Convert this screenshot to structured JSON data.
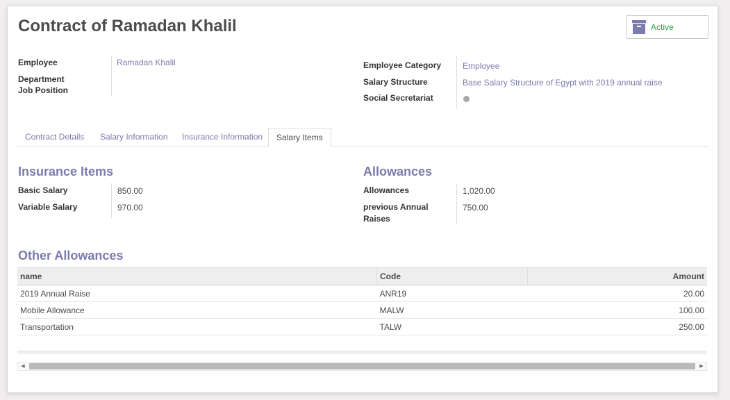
{
  "header": {
    "title": "Contract of Ramadan Khalil",
    "status_label": "Active",
    "status_icon": "archive-icon"
  },
  "left_fields": [
    {
      "label": "Employee",
      "value": "Ramadan Khalil"
    },
    {
      "label": "Department",
      "value": ""
    },
    {
      "label": "Job Position",
      "value": ""
    }
  ],
  "right_fields": {
    "employee_category_label": "Employee Category",
    "employee_category_value": "Employee",
    "salary_structure_label": "Salary Structure",
    "salary_structure_value": "Base Salary Structure of Egypt with 2019 annual raise",
    "social_secretariat_label": "Social Secretariat"
  },
  "tabs": [
    "Contract Details",
    "Salary Information",
    "Insurance Information",
    "Salary Items"
  ],
  "active_tab": "Salary Items",
  "insurance": {
    "title": "Insurance Items",
    "basic_label": "Basic Salary",
    "basic_value": "850.00",
    "variable_label": "Variable Salary",
    "variable_value": "970.00"
  },
  "allowances": {
    "title": "Allowances",
    "allowances_label": "Allowances",
    "allowances_value": "1,020.00",
    "raises_label_1": "previous Annual",
    "raises_label_2": "Raises",
    "raises_value": "750.00"
  },
  "other_allowances": {
    "title": "Other Allowances",
    "columns": [
      "name",
      "Code",
      "Amount"
    ],
    "rows": [
      {
        "name": "2019 Annual Raise",
        "code": "ANR19",
        "amount": "20.00"
      },
      {
        "name": "Mobile Allowance",
        "code": "MALW",
        "amount": "100.00"
      },
      {
        "name": "Transportation",
        "code": "TALW",
        "amount": "250.00"
      }
    ]
  },
  "colors": {
    "accent": "#7c7bad",
    "active_green": "#28a745",
    "dot_gray": "#a8a8a8"
  }
}
